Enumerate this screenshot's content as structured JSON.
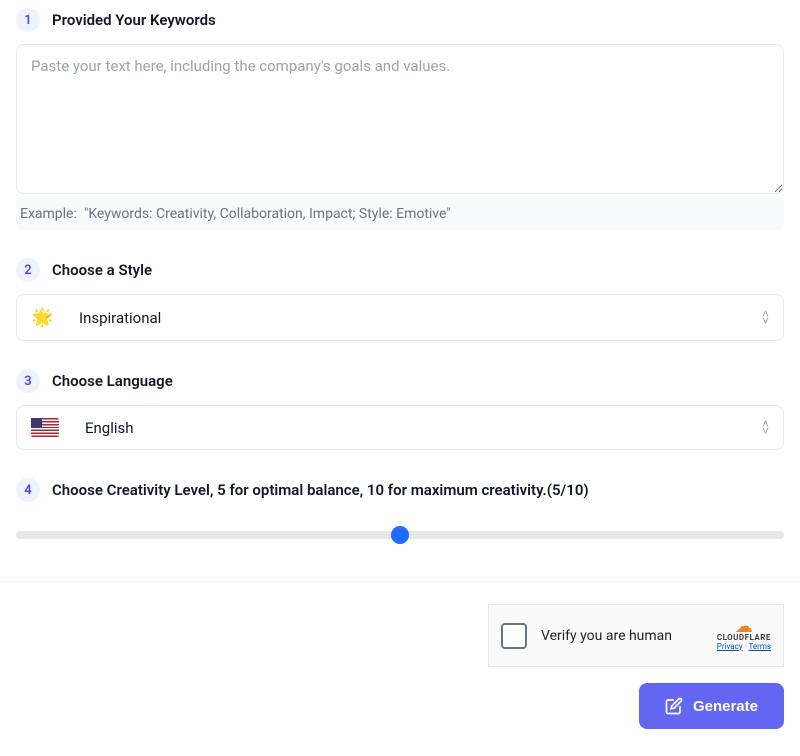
{
  "steps": {
    "s1": {
      "num": "1",
      "title": "Provided Your Keywords"
    },
    "s2": {
      "num": "2",
      "title": "Choose a Style"
    },
    "s3": {
      "num": "3",
      "title": "Choose Language"
    },
    "s4": {
      "num": "4",
      "title": "Choose Creativity Level, 5 for optimal balance, 10 for maximum creativity.(5/10)"
    }
  },
  "keywords": {
    "placeholder": "Paste your text here, including the company's goals and values.",
    "example_label": "Example:",
    "example_text": "\"Keywords: Creativity, Collaboration, Impact; Style: Emotive\""
  },
  "style": {
    "icon": "🌟",
    "selected": "Inspirational"
  },
  "language": {
    "selected": "English"
  },
  "creativity": {
    "min": 0,
    "max": 10,
    "value": 5
  },
  "captcha": {
    "text": "Verify you are human",
    "brand": "CLOUDFLARE",
    "privacy": "Privacy",
    "terms": "Terms"
  },
  "generate": {
    "label": "Generate"
  }
}
